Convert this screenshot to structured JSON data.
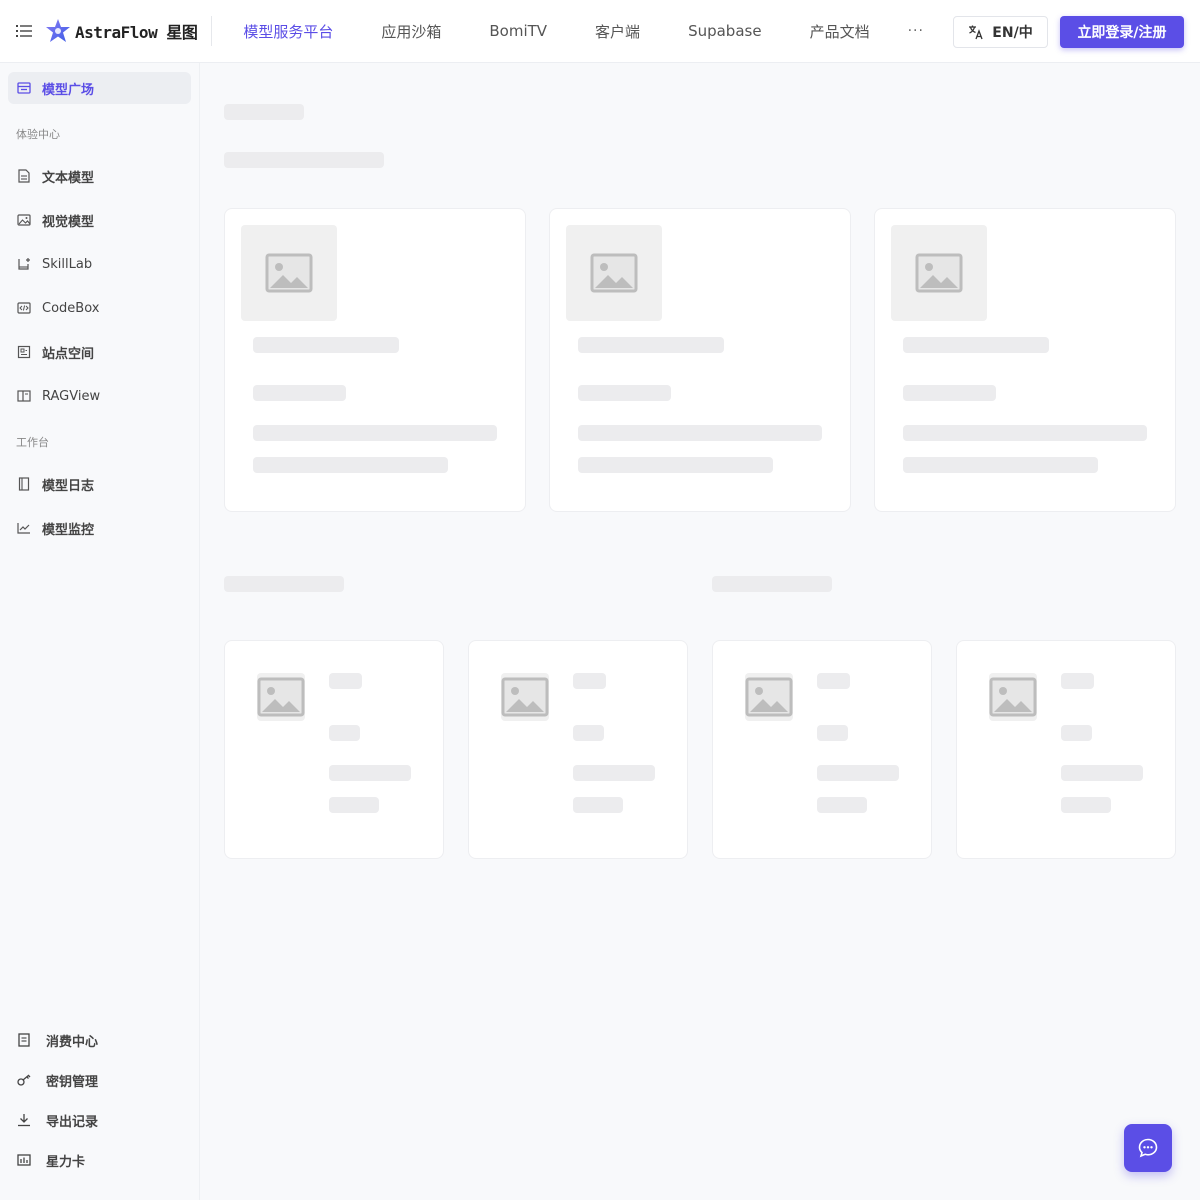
{
  "brand": {
    "name": "AstraFlow 星图",
    "accent": "#5b4ee6"
  },
  "nav": {
    "items": [
      "模型服务平台",
      "应用沙箱",
      "BomiTV",
      "客户端",
      "Supabase",
      "产品文档"
    ],
    "more": "···"
  },
  "header": {
    "lang_label": "EN/中",
    "login_label": "立即登录/注册"
  },
  "sidebar": {
    "top_item": "模型广场",
    "group_experience": "体验中心",
    "experience_items": [
      "文本模型",
      "视觉模型",
      "SkillLab",
      "CodeBox",
      "站点空间",
      "RAGView"
    ],
    "group_workbench": "工作台",
    "workbench_items": [
      "模型日志",
      "模型监控"
    ],
    "bottom_items": [
      "消费中心",
      "密钥管理",
      "导出记录",
      "星力卡"
    ]
  }
}
